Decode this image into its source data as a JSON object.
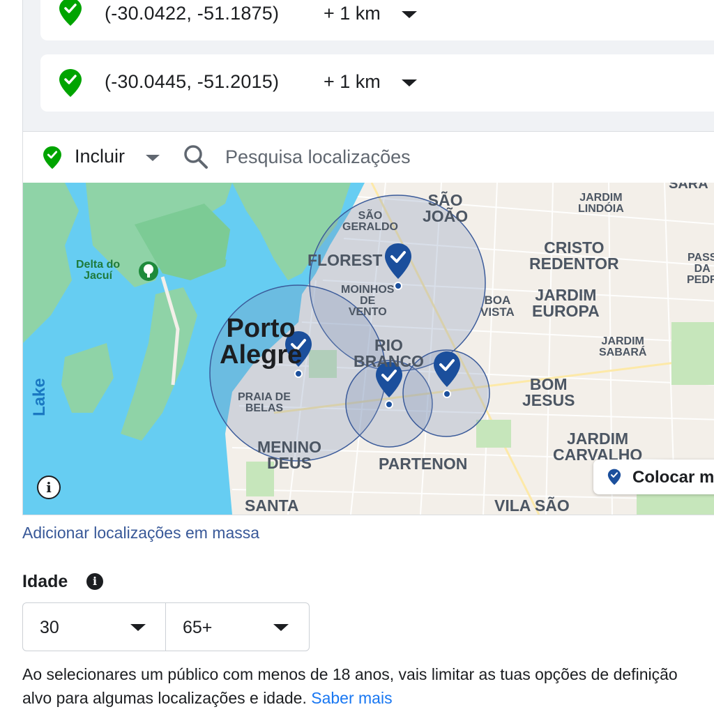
{
  "locations": [
    {
      "coords": "(-30.0422, -51.1875)",
      "radius": "+ 1 km"
    },
    {
      "coords": "(-30.0445, -51.2015)",
      "radius": "+ 1 km"
    }
  ],
  "search": {
    "include_label": "Incluir",
    "placeholder": "Pesquisa localizações"
  },
  "map": {
    "labels": {
      "delta": "Delta do\nJacuí",
      "lake": "Lake",
      "sao_geraldo": "SÃO\nGERALDO",
      "sao_joao": "SÃO\nJOÃO",
      "jardim_lindoia": "JARDIM\nLINDÓIA",
      "floresta": "FLOREST",
      "cristo_redentor": "CRISTO\nREDENTOR",
      "moinhos": "MOINHOS\nDE\nVENTO",
      "boa_vista": "BOA\nVISTA",
      "jardim_europa": "JARDIM\nEUROPA",
      "porto_alegre": "Porto\nAlegre",
      "rio_branco": "RIO\nBRANCO",
      "jardim_sabara": "JARDIM\nSABARÁ",
      "praia_belas": "PRAIA DE\nBELAS",
      "bom_jesus": "BOM\nJESUS",
      "menino_deus": "MENINO\nDEUS",
      "partenon": "PARTENON",
      "jardim_carvalho": "JARDIM\nCARVALHO",
      "santa": "SANTA",
      "vila_sao": "VILA SÃO",
      "sarandi": "SARA",
      "passo": "PASS\nDA\nPEDR"
    },
    "drop_pin_label": "Colocar m"
  },
  "bulk_link": "Adicionar localizações em massa",
  "age": {
    "title": "Idade",
    "min": "30",
    "max": "65+"
  },
  "disclaimer": {
    "line1": "Ao selecionares um público com menos de 18 anos, vais limitar as tuas opções de definição",
    "line2": "alvo para algumas localizações e idade.",
    "link": "Saber mais"
  },
  "colors": {
    "pin_green": "#00a400",
    "pin_blue": "#1b4f9c",
    "link_blue": "#1877f2",
    "water": "#66cdf2"
  }
}
